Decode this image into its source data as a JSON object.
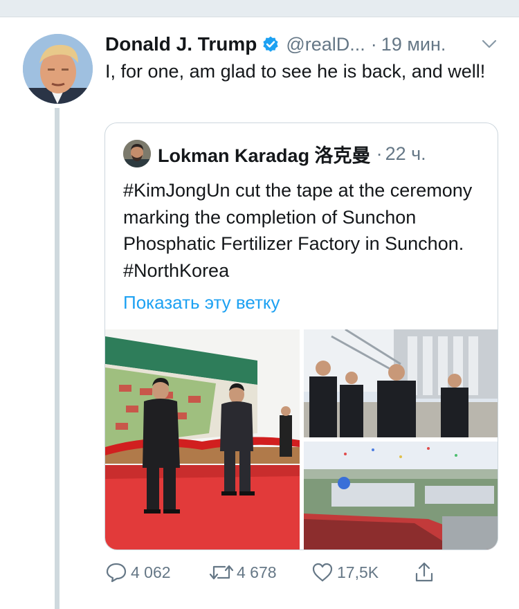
{
  "tweet": {
    "author_name": "Donald J. Trump",
    "handle": "@realD...",
    "separator": "·",
    "time": "19 мин.",
    "text": "I, for one, am glad to see he is back, and well!"
  },
  "quote": {
    "author_name": "Lokman Karadag 洛克曼",
    "separator": "·",
    "time": "22 ч.",
    "text": "#KimJongUn cut the tape at the ceremony marking the completion of Sunchon Phosphatic Fertilizer Factory in Sunchon. #NorthKorea",
    "show_thread": "Показать эту ветку"
  },
  "actions": {
    "reply_count": "4 062",
    "retweet_count": "4 678",
    "like_count": "17,5K"
  },
  "icons": {
    "verified": "verified-badge-icon",
    "caret": "chevron-down-icon",
    "reply": "reply-icon",
    "retweet": "retweet-icon",
    "like": "heart-icon",
    "share": "share-icon"
  },
  "colors": {
    "accent": "#1da1f2",
    "secondary_text": "#657786",
    "border": "#ccd6dd"
  }
}
